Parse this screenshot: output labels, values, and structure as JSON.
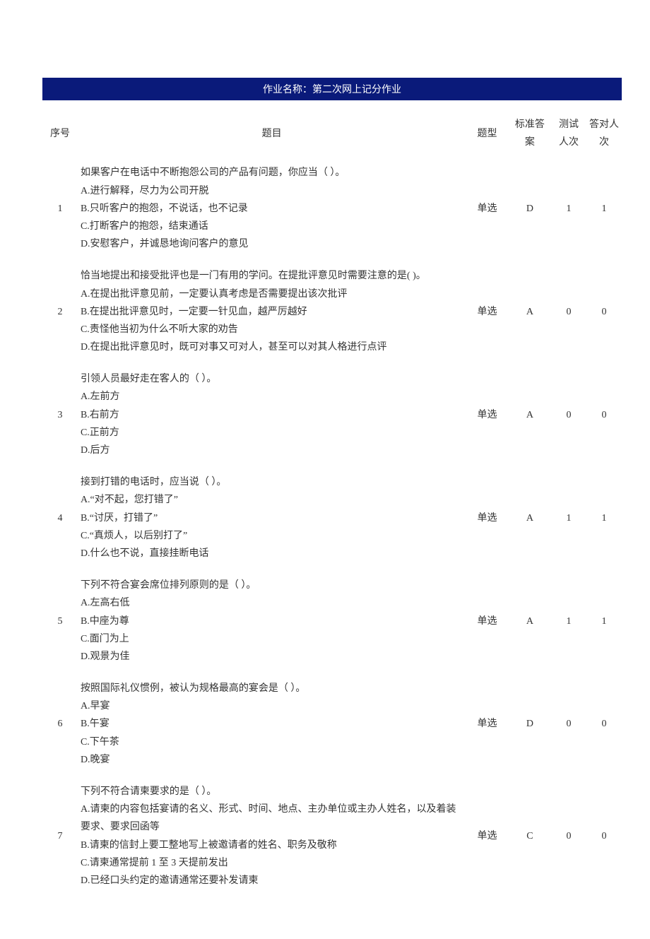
{
  "title": "作业名称：第二次网上记分作业",
  "headers": {
    "seq": "序号",
    "question": "题目",
    "type": "题型",
    "answer": "标准答案",
    "tested": "测试人次",
    "correct": "答对人次"
  },
  "rows": [
    {
      "seq": "1",
      "question": "如果客户在电话中不断抱怨公司的产品有问题，你应当（ ）。\nA.进行解释，尽力为公司开脱\nB.只听客户的抱怨，不说话，也不记录\nC.打断客户的抱怨，结束通话\nD.安慰客户，并诚恳地询问客户的意见",
      "type": "单选",
      "answer": "D",
      "tested": "1",
      "correct": "1"
    },
    {
      "seq": "2",
      "question": "恰当地提出和接受批评也是一门有用的学问。在提批评意见时需要注意的是( )。\nA.在提出批评意见前，一定要认真考虑是否需要提出该次批评\nB.在提出批评意见时，一定要一针见血，越严厉越好\nC.责怪他当初为什么不听大家的劝告\nD.在提出批评意见时，既可对事又可对人，甚至可以对其人格进行点评",
      "type": "单选",
      "answer": "A",
      "tested": "0",
      "correct": "0"
    },
    {
      "seq": "3",
      "question": "引领人员最好走在客人的（ ）。\nA.左前方\nB.右前方\nC.正前方\nD.后方",
      "type": "单选",
      "answer": "A",
      "tested": "0",
      "correct": "0"
    },
    {
      "seq": "4",
      "question": "接到打错的电话时，应当说（ ）。\nA.“对不起，您打错了”\nB.“讨厌，打错了”\nC.“真烦人，以后别打了”\nD.什么也不说，直接挂断电话",
      "type": "单选",
      "answer": "A",
      "tested": "1",
      "correct": "1"
    },
    {
      "seq": "5",
      "question": "下列不符合宴会席位排列原则的是（ ）。\nA.左高右低\nB.中座为尊\nC.面门为上\nD.观景为佳",
      "type": "单选",
      "answer": "A",
      "tested": "1",
      "correct": "1"
    },
    {
      "seq": "6",
      "question": "按照国际礼仪惯例，被认为规格最高的宴会是（ ）。\nA.早宴\nB.午宴\nC.下午茶\nD.晚宴",
      "type": "单选",
      "answer": "D",
      "tested": "0",
      "correct": "0"
    },
    {
      "seq": "7",
      "question": "下列不符合请柬要求的是（ ）。\nA.请柬的内容包括宴请的名义、形式、时间、地点、主办单位或主办人姓名，以及着装要求、要求回函等\nB.请柬的信封上要工整地写上被邀请者的姓名、职务及敬称\nC.请柬通常提前 1 至 3 天提前发出\nD.已经口头约定的邀请通常还要补发请柬",
      "type": "单选",
      "answer": "C",
      "tested": "0",
      "correct": "0"
    }
  ]
}
